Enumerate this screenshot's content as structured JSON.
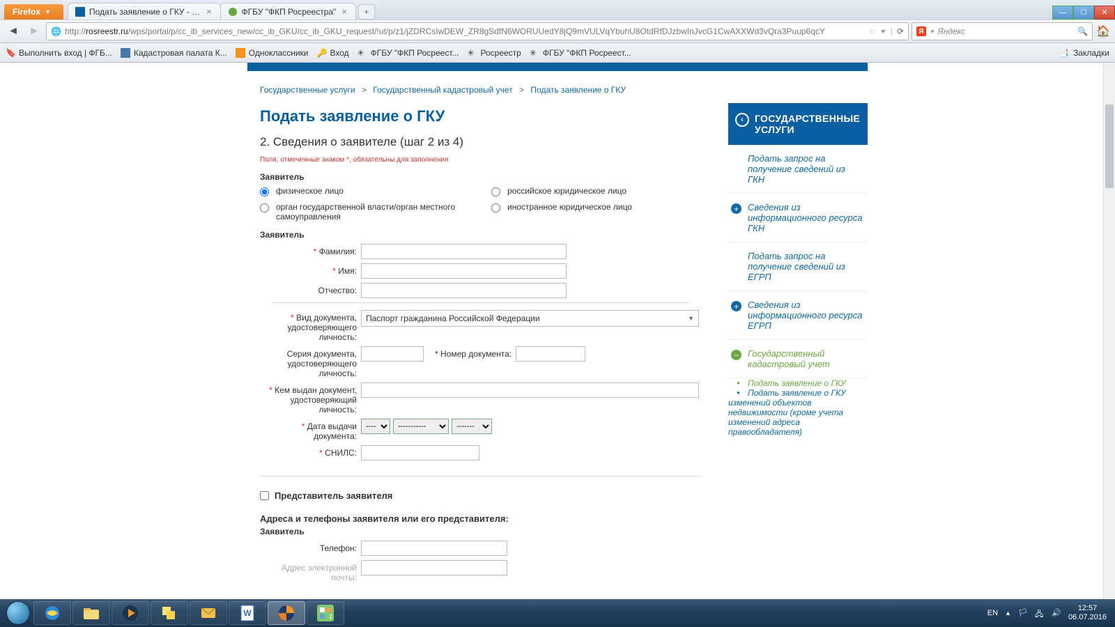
{
  "browser": {
    "name": "Firefox",
    "tabs": [
      {
        "title": "Подать заявление о ГКУ - Портал ус...",
        "favicon_color": "#0a5fa0"
      },
      {
        "title": "ФГБУ \"ФКП Росреестра\"",
        "favicon_color": "#6ba843"
      }
    ],
    "url_host": "rosreestr.ru",
    "url_path": "/wps/portal/p/cc_ib_services_new/cc_ib_GKU/cc_ib_GKU_request/!ut/p/z1/jZDRCsIwDEW_ZR8gSdfN6WORUUedY8jQ9mVULVqYbuhU8OtdRfDJzbwInJvcG1CwAXXWd3vQra3Puup6qcY",
    "search_placeholder": "Яндекс",
    "bookmarks": [
      "Выполнить вход | ФГБ...",
      "Кадастровая палата К...",
      "Одноклассники",
      "Вход",
      "ФГБУ \"ФКП Росреест...",
      "Росреестр",
      "ФГБУ \"ФКП Росреест..."
    ],
    "bookmarks_label_right": "Закладки"
  },
  "breadcrumbs": {
    "a": "Государственные услуги",
    "b": "Государственный кадастровый учет",
    "c": "Подать заявление о ГКУ"
  },
  "page": {
    "title": "Подать заявление о ГКУ",
    "step": "2. Сведения о заявителе (шаг 2 из 4)",
    "required_note": "Поля, отмеченные знаком *, обязательны для заполнения",
    "applicant_legend": "Заявитель",
    "radios": {
      "r1": "физическое лицо",
      "r2": "орган государственной власти/орган местного самоуправления",
      "r3": "российское юридическое лицо",
      "r4": "иностранное юридическое лицо"
    },
    "fields": {
      "surname": "Фамилия:",
      "name": "Имя:",
      "patronymic": "Отчество:",
      "doc_type": "Вид документа, удостоверяющего личность:",
      "doc_type_value": "Паспорт гражданина Российской Федерации",
      "doc_series": "Серия документа, удостоверяющего личность:",
      "doc_number": "Номер документа:",
      "issued_by": "Кем выдан документ, удостоверяющий личность:",
      "issue_date": "Дата выдачи документа:",
      "snils": "СНИЛС:",
      "date_day": "----",
      "date_month": "-----------",
      "date_year": "-------"
    },
    "rep_checkbox": "Представитель заявителя",
    "addresses_heading": "Адреса и телефоны заявителя или его представителя:",
    "addr_applicant": "Заявитель",
    "phone": "Телефон:",
    "email": "Адрес электронной почты:"
  },
  "sidebar": {
    "heading": "ГОСУДАРСТВЕННЫЕ УСЛУГИ",
    "items": [
      {
        "label": "Подать запрос на получение сведений из ГКН",
        "badge": null
      },
      {
        "label": "Сведения из информационного ресурса ГКН",
        "badge": "+"
      },
      {
        "label": "Подать запрос на получение сведений из ЕГРП",
        "badge": null
      },
      {
        "label": "Сведения из информационного ресурса ЕГРП",
        "badge": "+"
      },
      {
        "label": "Государственный кадастровый учет",
        "badge": "-",
        "active": true
      }
    ],
    "subitems": [
      {
        "label": "Подать заявление о ГКУ",
        "active": true
      },
      {
        "label": "Подать заявление о ГКУ изменений объектов недвижимости (кроме учета изменений адреса правообладателя)",
        "active": false
      }
    ]
  },
  "taskbar": {
    "lang": "EN",
    "time": "12:57",
    "date": "06.07.2016"
  }
}
